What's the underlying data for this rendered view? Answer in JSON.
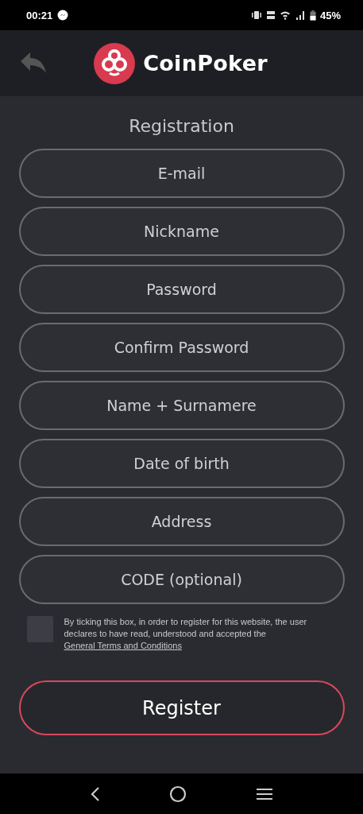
{
  "status_bar": {
    "time": "00:21",
    "battery": "45%"
  },
  "header": {
    "logo_text": "CoinPoker"
  },
  "title": "Registration",
  "fields": [
    {
      "placeholder": "E-mail"
    },
    {
      "placeholder": "Nickname"
    },
    {
      "placeholder": "Password"
    },
    {
      "placeholder": "Confirm Password"
    },
    {
      "placeholder": "Name + Surnamere"
    },
    {
      "placeholder": "Date of birth"
    },
    {
      "placeholder": "Address"
    },
    {
      "placeholder": "CODE (optional)"
    }
  ],
  "terms": {
    "checked": false,
    "text": "By ticking this box, in order to register for this website, the user declares to have read, understood and accepted the ",
    "link": "General Terms and Conditions"
  },
  "register_button": "Register"
}
